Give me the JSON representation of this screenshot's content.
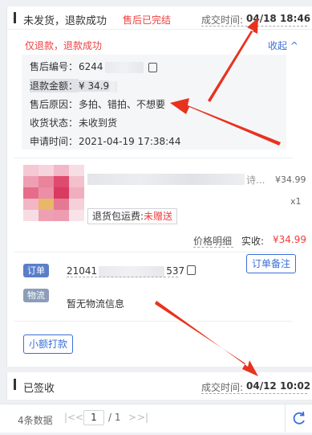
{
  "order1": {
    "status": "未发货，退款成功",
    "badge": "售后已完结",
    "time_label": "成交时间:",
    "time_value": "04/18 18:46",
    "refund_title": "仅退款，退款成功",
    "collapse_label": "收起 ^",
    "details": {
      "aftersale_no_label": "售后编号：",
      "aftersale_no_value": "6244",
      "refund_amount_label": "退款金额：",
      "refund_amount_value": "¥ 34.9",
      "reason_label": "售后原因：",
      "reason_value": "多拍、错拍、不想要",
      "receive_label": "收货状态：",
      "receive_value": "未收到货",
      "apply_time_label": "申请时间：",
      "apply_time_value": "2021-04-19 17:38:44"
    },
    "product": {
      "title_tail": "诗...",
      "price": "¥34.99",
      "qty": "x1",
      "shipping_insurance_label": "退货包运费:",
      "shipping_insurance_value": "未赠送",
      "price_detail_label": "价格明细",
      "actual_label": "实收:",
      "actual_value": "¥34.99"
    },
    "order_tag": "订单",
    "order_no_prefix": "21041",
    "order_no_suffix": "537",
    "order_note_button": "订单备注",
    "logistics_tag": "物流",
    "logistics_text": "暂无物流信息",
    "small_payment_button": "小额打款"
  },
  "order2": {
    "status": "已签收",
    "time_label": "成交时间:",
    "time_value": "04/12 10:02"
  },
  "footer": {
    "total": "4条数据",
    "first_icon": "|<",
    "prev_icon": "<",
    "page_value": "1",
    "page_total": "/ 1",
    "next_icon": ">",
    "last_icon": ">|"
  },
  "colors": {
    "accent_red": "#ef3f3f",
    "link_blue": "#3b6fd8",
    "tag_order": "#5a7ec9",
    "tag_logistics": "#8b9db8",
    "annotation_arrow": "#e8321e"
  },
  "icons": [
    "copy-icon",
    "refresh-icon",
    "first-page-icon",
    "prev-page-icon",
    "next-page-icon",
    "last-page-icon"
  ]
}
